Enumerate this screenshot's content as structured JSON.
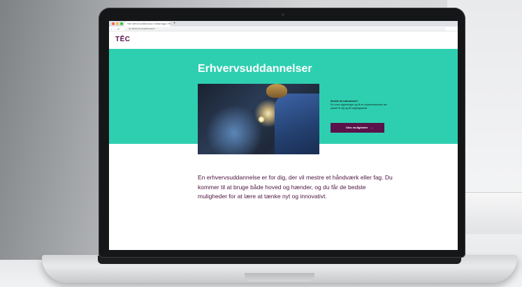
{
  "browser": {
    "tab_title": "TEC | Erhvervsuddannelser | Uddannelser | TEC",
    "tab_close": "×",
    "new_tab": "+",
    "url": "tec.dk/erhvervsuddannelser/",
    "nav_symbols": "‹ › ⟳"
  },
  "site": {
    "logo": "TĒC"
  },
  "hero": {
    "title": "Erhvervsuddannelser",
    "side_question": "Direkte fra folkeskolen?",
    "side_text": "Se vores fagretninger og få en uddannelsesstart der passer til dig og dit udgangspunkt.",
    "cta_label": "Oleo muligheder",
    "cta_arrow": "→",
    "color": "#2ecfb1"
  },
  "intro": {
    "text": "En erhvervsuddannelse er for dig, der vil mestre et håndværk eller fag. Du kommer til at bruge både hoved og hænder, og du får de bedste muligheder for at lære at tænke nyt og innovativt."
  },
  "colors": {
    "brand": "#5b1149",
    "accent": "#2ecfb1"
  },
  "icons": {
    "window_controls": [
      "close-dot",
      "minimize-dot",
      "maximize-dot"
    ],
    "hero_image": "welder-photo"
  }
}
